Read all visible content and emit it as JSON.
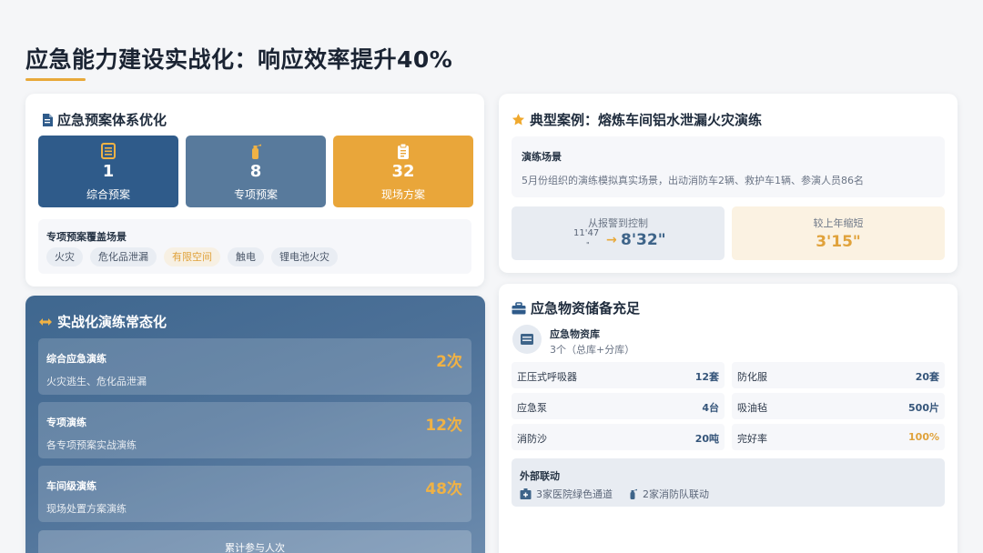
{
  "page": {
    "title": "应急能力建设实战化：响应效率提升40%"
  },
  "plan_card": {
    "title": "应急预案体系优化",
    "stats": [
      {
        "value": "1",
        "label": "综合预案",
        "icon": "document-icon",
        "color": "#2f5b8a"
      },
      {
        "value": "8",
        "label": "专项预案",
        "icon": "fire-extinguisher-icon",
        "color": "#587a9c"
      },
      {
        "value": "32",
        "label": "现场方案",
        "icon": "clipboard-icon",
        "color": "#e9a63a"
      }
    ],
    "scope_title": "专项预案覆盖场景",
    "tags": [
      {
        "label": "火灾",
        "highlight": false
      },
      {
        "label": "危化品泄漏",
        "highlight": false
      },
      {
        "label": "有限空间",
        "highlight": true
      },
      {
        "label": "触电",
        "highlight": false
      },
      {
        "label": "锂电池火灾",
        "highlight": false
      }
    ]
  },
  "drill_card": {
    "title": "实战化演练常态化",
    "rows": [
      {
        "name": "综合应急演练",
        "desc": "火灾逃生、危化品泄漏",
        "count": "2次"
      },
      {
        "name": "专项演练",
        "desc": "各专项预案实战演练",
        "count": "12次"
      },
      {
        "name": "车间级演练",
        "desc": "现场处置方案演练",
        "count": "48次"
      }
    ],
    "total_label": "累计参与人次"
  },
  "case_card": {
    "title": "典型案例：熔炼车间铝水泄漏火灾演练",
    "scene_title": "演练场景",
    "scene_desc": "5月份组织的演练模拟真实场景，出动消防车2辆、救护车1辆、参演人员86名",
    "response": {
      "label": "从报警到控制",
      "old_time": "11'47",
      "old_dot": "\"",
      "new_time": "8'32\""
    },
    "reduction": {
      "label": "较上年缩短",
      "value": "3'15\""
    }
  },
  "supply_card": {
    "title": "应急物资储备充足",
    "warehouse_name": "应急物资库",
    "warehouse_sub": "3个（总库+分库）",
    "items": [
      {
        "name": "正压式呼吸器",
        "qty": "12套",
        "gold": false
      },
      {
        "name": "防化服",
        "qty": "20套",
        "gold": false
      },
      {
        "name": "应急泵",
        "qty": "4台",
        "gold": false
      },
      {
        "name": "吸油毡",
        "qty": "500片",
        "gold": false
      },
      {
        "name": "消防沙",
        "qty": "20吨",
        "gold": false
      },
      {
        "name": "完好率",
        "qty": "100%",
        "gold": true
      }
    ],
    "external_title": "外部联动",
    "external_items": [
      {
        "label": "3家医院绿色通道",
        "icon": "hospital-icon"
      },
      {
        "label": "2家消防队联动",
        "icon": "fire-extinguisher-icon"
      }
    ]
  },
  "colors": {
    "accent": "#e8a93a",
    "primary_blue": "#2f5b8a",
    "steel_blue": "#587a9c"
  }
}
